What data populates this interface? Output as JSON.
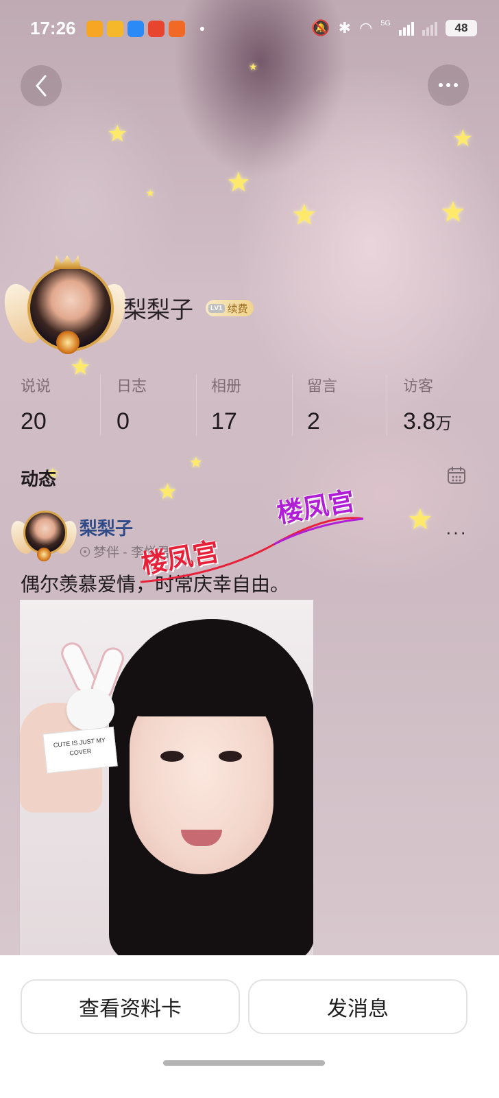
{
  "status_bar": {
    "time": "17:26",
    "network": "5G",
    "battery": "48",
    "notification_icons": [
      "weibo-icon",
      "bilibili-icon",
      "qq-browser-icon",
      "app-icon",
      "xianyu-icon"
    ]
  },
  "profile": {
    "name": "梨梨子",
    "vip_level": "LV1",
    "vip_action": "续费"
  },
  "stats": [
    {
      "label": "说说",
      "value": "20",
      "unit": ""
    },
    {
      "label": "日志",
      "value": "0",
      "unit": ""
    },
    {
      "label": "相册",
      "value": "17",
      "unit": ""
    },
    {
      "label": "留言",
      "value": "2",
      "unit": ""
    },
    {
      "label": "访客",
      "value": "3.8",
      "unit": "万"
    }
  ],
  "feed": {
    "title": "动态",
    "post": {
      "author": "梨梨子",
      "source": "梦伴 - 李悦君",
      "text": "偶尔羡慕爱情，时常庆幸自由。",
      "image_card_text": "CUTE IS JUST MY COVER"
    }
  },
  "watermark": {
    "text_red": "楼凤宫",
    "text_purple": "楼凤宫"
  },
  "actions": {
    "view_profile": "查看资料卡",
    "send_message": "发消息"
  },
  "colors": {
    "author_link": "#2f4a86",
    "star": "#ffe96b",
    "watermark_red": "#e8213b",
    "watermark_purple": "#b01fd6"
  }
}
